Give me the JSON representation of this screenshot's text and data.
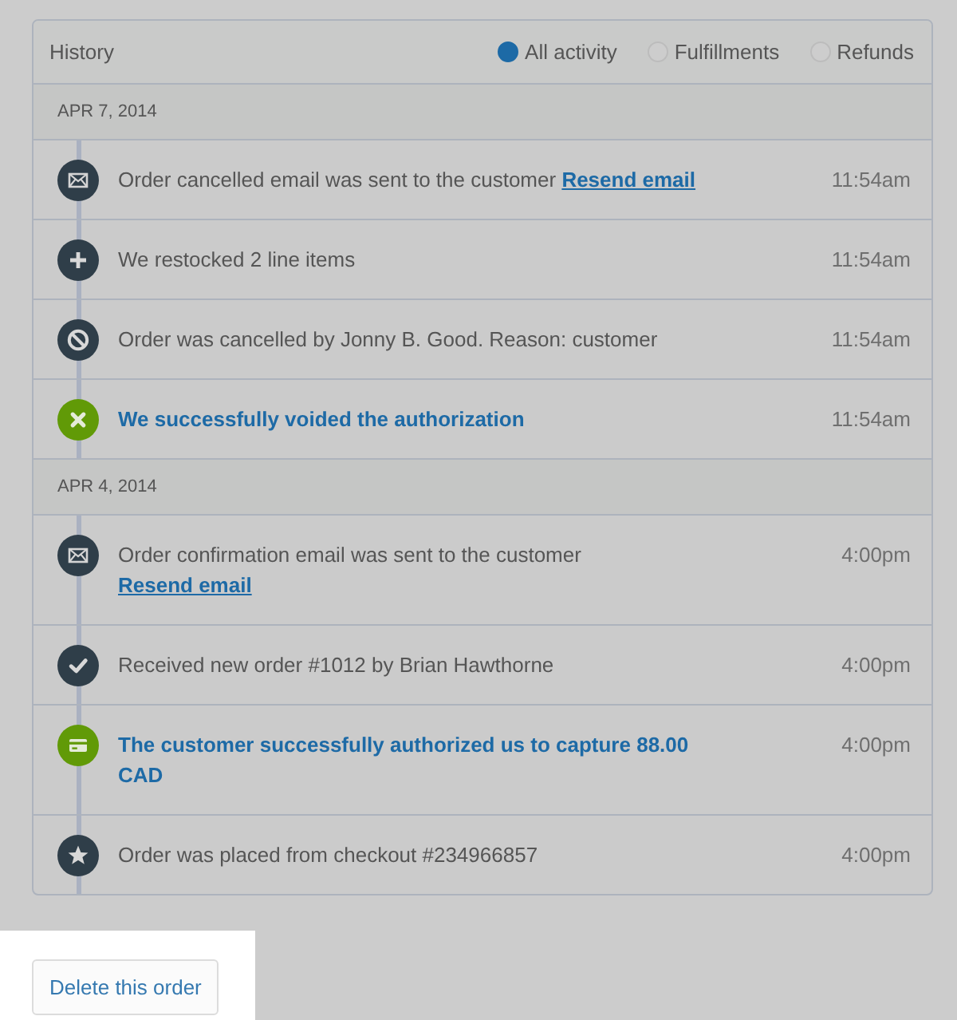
{
  "history": {
    "title": "History",
    "filters": [
      {
        "label": "All activity",
        "selected": true
      },
      {
        "label": "Fulfillments",
        "selected": false
      },
      {
        "label": "Refunds",
        "selected": false
      }
    ],
    "groups": [
      {
        "date": "APR 7, 2014",
        "events": [
          {
            "kind": "email",
            "highlighted": false,
            "text": "Order cancelled email was sent to the customer",
            "link": "Resend email",
            "time": "11:54am"
          },
          {
            "kind": "restock",
            "highlighted": false,
            "text": "We restocked 2 line items",
            "time": "11:54am"
          },
          {
            "kind": "cancel",
            "highlighted": false,
            "text": "Order was cancelled by Jonny B. Good. Reason: customer",
            "time": "11:54am"
          },
          {
            "kind": "void",
            "highlighted": true,
            "text": "We successfully voided the authorization",
            "time": "11:54am"
          }
        ]
      },
      {
        "date": "APR 4, 2014",
        "events": [
          {
            "kind": "email",
            "highlighted": false,
            "text": "Order confirmation email was sent to the customer",
            "link": "Resend email",
            "time": "4:00pm"
          },
          {
            "kind": "order",
            "highlighted": false,
            "text": "Received new order #1012 by Brian Hawthorne",
            "time": "4:00pm"
          },
          {
            "kind": "authorization",
            "highlighted": true,
            "text": "The customer successfully authorized us to capture 88.00 CAD",
            "time": "4:00pm"
          },
          {
            "kind": "checkout",
            "highlighted": false,
            "text": "Order was placed from checkout #234966857",
            "time": "4:00pm"
          }
        ]
      }
    ]
  },
  "delete_button": {
    "label": "Delete this order",
    "highlighted": true
  }
}
